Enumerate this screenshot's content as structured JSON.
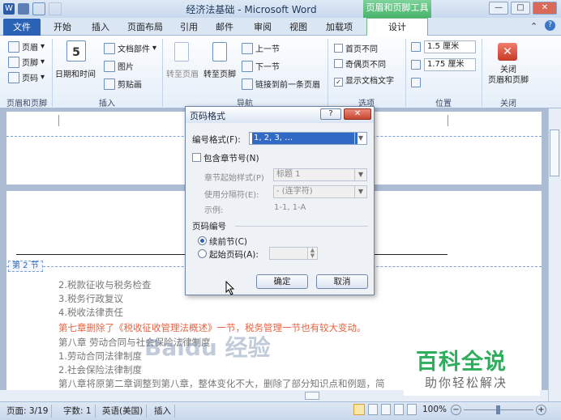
{
  "window": {
    "title": "经济法基础 - Microsoft Word",
    "context_group": "页眉和页脚工具",
    "controls": [
      "—",
      "□",
      "✕"
    ]
  },
  "tabs": {
    "file": "文件",
    "items": [
      "开始",
      "插入",
      "页面布局",
      "引用",
      "邮件",
      "审阅",
      "视图",
      "加载项"
    ],
    "active": "设计"
  },
  "ribbon": {
    "header_footer": {
      "header": "页眉",
      "footer": "页脚",
      "page_number": "页码",
      "label": "页眉和页脚"
    },
    "insert": {
      "date_time": "日期和时间",
      "doc_parts": "文档部件",
      "picture": "图片",
      "clip_art": "剪贴画",
      "label": "插入"
    },
    "nav": {
      "goto_header": "转至页眉",
      "goto_footer": "转至页脚",
      "prev": "上一节",
      "next": "下一节",
      "link_prev": "链接到前一条页眉",
      "label": "导航"
    },
    "options": {
      "diff_first": "首页不同",
      "diff_odd_even": "奇偶页不同",
      "show_doc_text": "显示文档文字",
      "label": "选项"
    },
    "position": {
      "header_pos": "1.5 厘米",
      "footer_pos": "1.75 厘米",
      "label": "位置"
    },
    "close": {
      "label_btn": "关闭\n页眉和页脚",
      "line1": "关闭",
      "line2": "页眉和页脚",
      "label": "关闭"
    }
  },
  "document": {
    "section_tag": "第 2 节",
    "lines": [
      {
        "text": "2.税款征收与税务检查",
        "color": "#7a7a7a"
      },
      {
        "text": "3.税务行政复议",
        "color": "#7a7a7a"
      },
      {
        "text": "4.税收法律责任",
        "color": "#7a7a7a"
      },
      {
        "text": "第七章删除了《税收征收管理法概述》一节，税务管理一节也有较大变动。",
        "color": "#e8623f"
      },
      {
        "text": "第八章 劳动合同与社会保险法律制度",
        "color": "#7a7a7a"
      },
      {
        "text": "1.劳动合同法律制度",
        "color": "#7a7a7a"
      },
      {
        "text": "2.社会保险法律制度",
        "color": "#7a7a7a"
      },
      {
        "text": "第八章将原第二章调整到第八章，整体变化不大，删除了部分知识点和例题，简",
        "color": "#7a7a7a"
      }
    ]
  },
  "dialog": {
    "title": "页码格式",
    "help": "?",
    "close": "✕",
    "number_format_label": "编号格式(F):",
    "number_format_value": "1, 2, 3, …",
    "include_chapter": "包含章节号(N)",
    "chapter_style_label": "章节起始样式(P)",
    "chapter_style_value": "标题 1",
    "separator_label": "使用分隔符(E):",
    "separator_value": "-  (连字符)",
    "example_label": "示例:",
    "example_value": "1-1, 1-A",
    "page_numbering_label": "页码编号",
    "continue_prev": "续前节(C)",
    "start_at": "起始页码(A):",
    "start_at_value": "",
    "ok": "确定",
    "cancel": "取消"
  },
  "statusbar": {
    "page": "页面: 3/19",
    "words": "字数: 1",
    "language": "英语(美国)",
    "mode": "插入",
    "zoom": "100%"
  },
  "watermark": {
    "title": "百科全说",
    "subtitle": "助你轻松解决",
    "baidu": "Baidu 经验"
  },
  "colors": {
    "file_tab": "#2a62b5",
    "context": "#47b36a",
    "accent_red": "#e8623f",
    "watermark_green": "#2eae5c"
  }
}
